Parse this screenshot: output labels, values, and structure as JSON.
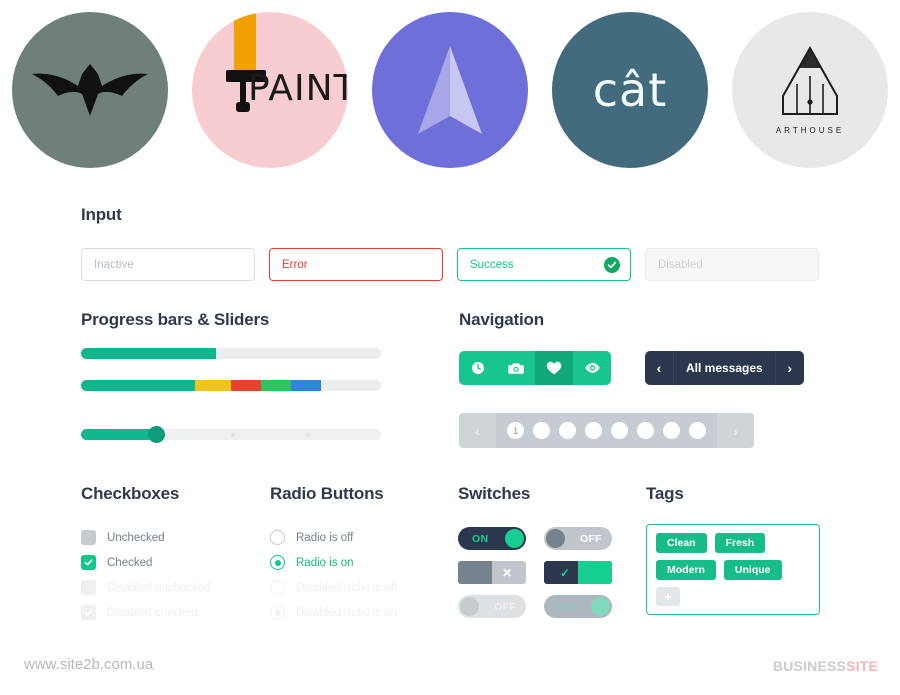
{
  "logos": [
    {
      "name": "bat-logo",
      "bg": "#6e8079",
      "kind": "bat"
    },
    {
      "name": "paint-logo",
      "bg": "#f8cdd1",
      "kind": "paint",
      "text": "PAINT",
      "stripe": "#f0a000"
    },
    {
      "name": "plane-logo",
      "bg": "#6f6fda",
      "kind": "plane"
    },
    {
      "name": "cat-logo",
      "bg": "#426b7e",
      "kind": "cat",
      "text": "cât"
    },
    {
      "name": "arthouse-logo",
      "bg": "#e8e8e8",
      "kind": "pencil",
      "text": "ARTHOUSE"
    }
  ],
  "sections": {
    "input": "Input",
    "progress": "Progress bars & Sliders",
    "navigation": "Navigation",
    "checkboxes": "Checkboxes",
    "radio": "Radio Buttons",
    "switches": "Switches",
    "tags": "Tags"
  },
  "inputs": [
    {
      "state": "inactive",
      "placeholder": "Inactive",
      "value": ""
    },
    {
      "state": "error",
      "placeholder": "Error",
      "value": ""
    },
    {
      "state": "success",
      "placeholder": "Success",
      "value": "",
      "icon": "check-circle-icon"
    },
    {
      "state": "disabled",
      "placeholder": "Disabled",
      "value": ""
    }
  ],
  "colors": {
    "accent_green": "#16c58f",
    "error_red": "#e2402f",
    "success_green": "#0fa960",
    "dark_navy": "#2b374d",
    "muted_gray": "#c6ccd1",
    "track_gray": "#ebedee"
  },
  "progress": {
    "bar1": {
      "percent": 45,
      "color": "#0fb88c"
    },
    "bar2": {
      "segments": [
        {
          "percent": 38,
          "color": "#0fb88c"
        },
        {
          "percent": 12,
          "color": "#f4c41c"
        },
        {
          "percent": 10,
          "color": "#e8422f"
        },
        {
          "percent": 10,
          "color": "#2cc45e"
        },
        {
          "percent": 10,
          "color": "#2f86e0"
        }
      ]
    },
    "slider": {
      "value": 25,
      "ticks": [
        50,
        75
      ],
      "knob_color": "#0d9e7c",
      "fill_color": "#11b88e"
    }
  },
  "navigation": {
    "icon_buttons": [
      {
        "icon": "clock-icon",
        "active": false
      },
      {
        "icon": "camera-icon",
        "active": false
      },
      {
        "icon": "heart-icon",
        "active": true
      },
      {
        "icon": "eye-icon",
        "active": false
      }
    ],
    "messages_button": {
      "label": "All messages",
      "prev": "‹",
      "next": "›"
    },
    "pagination": {
      "prev": "‹",
      "next": "›",
      "pages": [
        "1",
        "",
        "",
        "",
        "",
        "",
        "",
        ""
      ],
      "current": "1"
    }
  },
  "checkboxes": [
    {
      "label": "Unchecked",
      "checked": false,
      "disabled": false
    },
    {
      "label": "Checked",
      "checked": true,
      "disabled": false
    },
    {
      "label": "Disabled unchecked",
      "checked": false,
      "disabled": true
    },
    {
      "label": "Disabled checked",
      "checked": true,
      "disabled": true
    }
  ],
  "radios": [
    {
      "label": "Radio is off",
      "checked": false,
      "disabled": false
    },
    {
      "label": "Radio is on",
      "checked": true,
      "disabled": false
    },
    {
      "label": "Disabled radio is off",
      "checked": false,
      "disabled": true
    },
    {
      "label": "Disabled radio is on",
      "checked": true,
      "disabled": true
    }
  ],
  "switches": [
    {
      "id": "sw-on-dark",
      "label": "ON",
      "state": "on",
      "style": "pill",
      "track": "#2b374d",
      "knob": "#17cf93",
      "text_color": "#17cf93",
      "knob_side": "right"
    },
    {
      "id": "sw-off-gray",
      "label": "OFF",
      "state": "off",
      "style": "pill",
      "track": "#c0c6cb",
      "knob": "#76828c",
      "text_color": "#ffffff",
      "knob_side": "left"
    },
    {
      "id": "sw-cross-gray",
      "label": "✕",
      "state": "off",
      "style": "square",
      "track": "#c0c6cb",
      "knob": "#76828c",
      "text_color": "#ffffff",
      "knob_side": "left"
    },
    {
      "id": "sw-check-dark",
      "label": "✓",
      "state": "on",
      "style": "square",
      "track": "#2b374d",
      "knob": "#17cf93",
      "text_color": "#17cf93",
      "knob_side": "right"
    },
    {
      "id": "sw-off-disabled",
      "label": "OFF",
      "state": "off",
      "style": "pill",
      "track": "#dde1e4",
      "knob": "#c6cbd0",
      "text_color": "#eef0f2",
      "knob_side": "left"
    },
    {
      "id": "sw-on-disabled",
      "label": "ON",
      "state": "on",
      "style": "pill",
      "track": "#aeb7bd",
      "knob": "#7fd9bd",
      "text_color": "#8fc8b6",
      "knob_side": "right"
    }
  ],
  "tags": {
    "items": [
      "Clean",
      "Fresh",
      "Modern",
      "Unique"
    ],
    "add_label": "+",
    "border_color": "#1dc08c",
    "tag_color": "#17bd89"
  },
  "footer": {
    "site": "www.site2b.com.ua",
    "brand_first": "BUSINESS",
    "brand_second": "SITE"
  }
}
